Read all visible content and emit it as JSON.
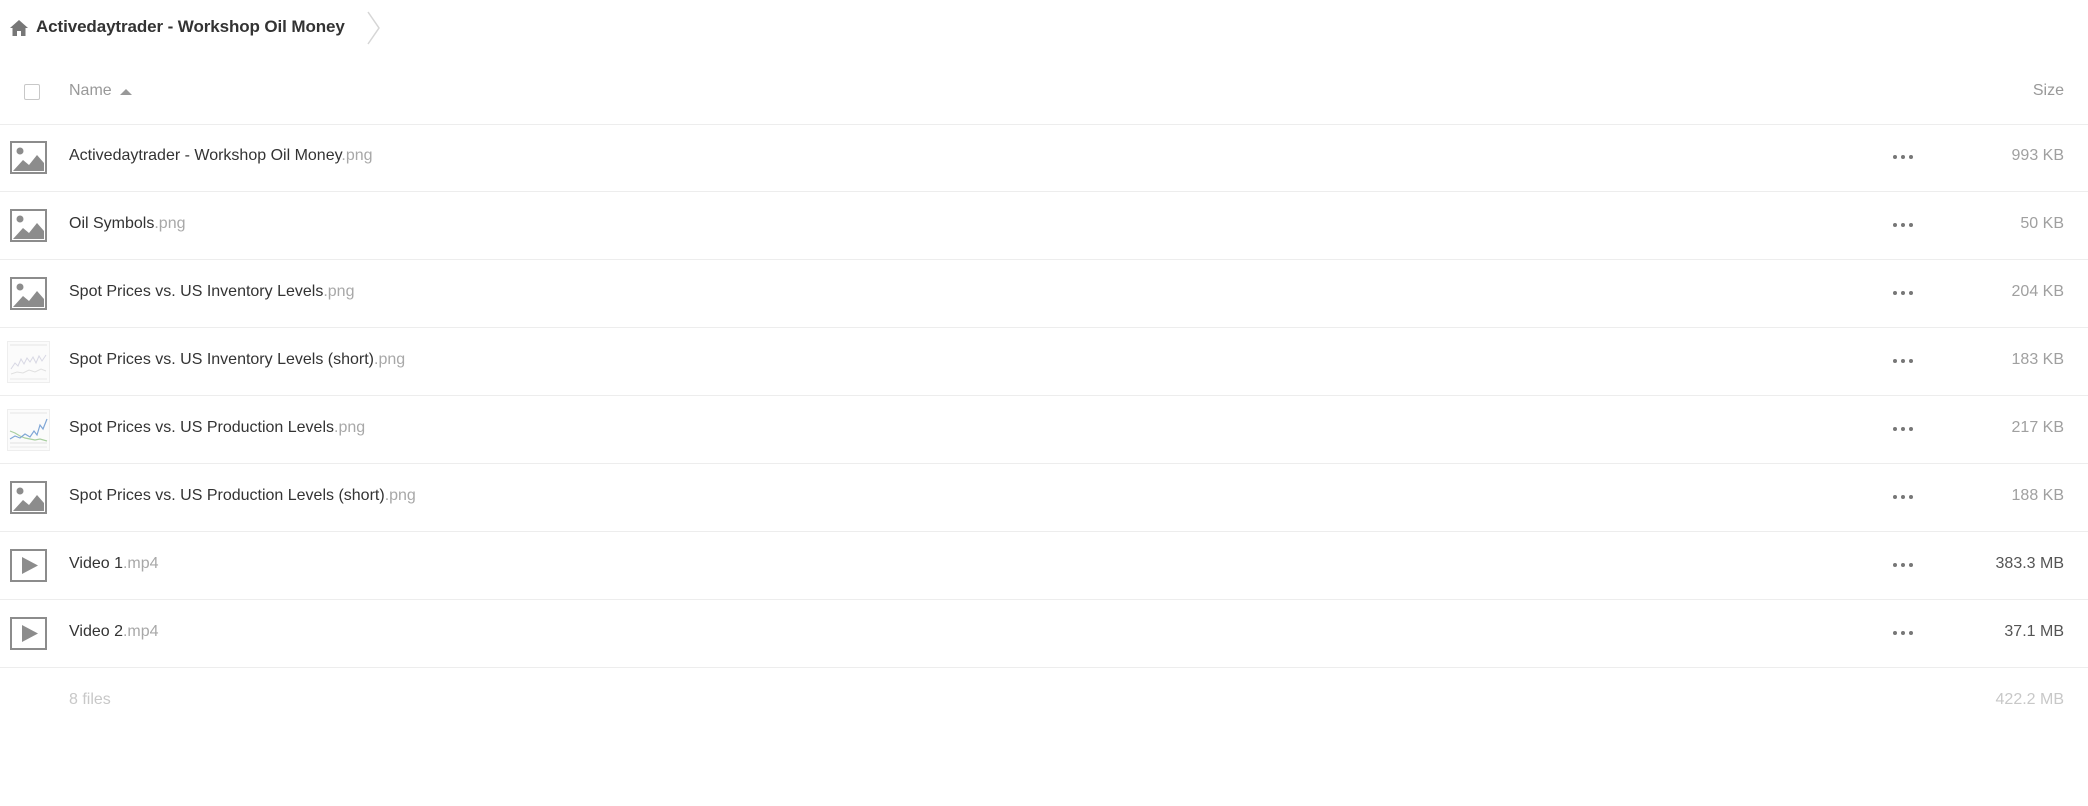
{
  "breadcrumb": {
    "icon": "home-icon",
    "title": "Activedaytrader - Workshop Oil Money"
  },
  "header": {
    "name_label": "Name",
    "size_label": "Size",
    "sort": "ascending"
  },
  "files": [
    {
      "base": "Activedaytrader - Workshop Oil Money",
      "ext": ".png",
      "size": "993 KB",
      "icon": "image-icon"
    },
    {
      "base": "Oil Symbols",
      "ext": ".png",
      "size": "50 KB",
      "icon": "image-icon"
    },
    {
      "base": "Spot Prices vs. US Inventory Levels",
      "ext": ".png",
      "size": "204 KB",
      "icon": "image-icon"
    },
    {
      "base": "Spot Prices vs. US Inventory Levels (short)",
      "ext": ".png",
      "size": "183 KB",
      "icon": "thumbnail-preview"
    },
    {
      "base": "Spot Prices vs. US Production Levels",
      "ext": ".png",
      "size": "217 KB",
      "icon": "thumbnail-preview"
    },
    {
      "base": "Spot Prices vs. US Production Levels (short)",
      "ext": ".png",
      "size": "188 KB",
      "icon": "image-icon"
    },
    {
      "base": "Video 1",
      "ext": ".mp4",
      "size": "383.3 MB",
      "icon": "video-icon"
    },
    {
      "base": "Video 2",
      "ext": ".mp4",
      "size": "37.1 MB",
      "icon": "video-icon"
    }
  ],
  "summary": {
    "file_count": "8 files",
    "total_size": "422.2 MB"
  },
  "colors": {
    "icon_gray": "#8c8c8c",
    "divider": "#ededed",
    "ext_gray": "#a8a8a8"
  }
}
